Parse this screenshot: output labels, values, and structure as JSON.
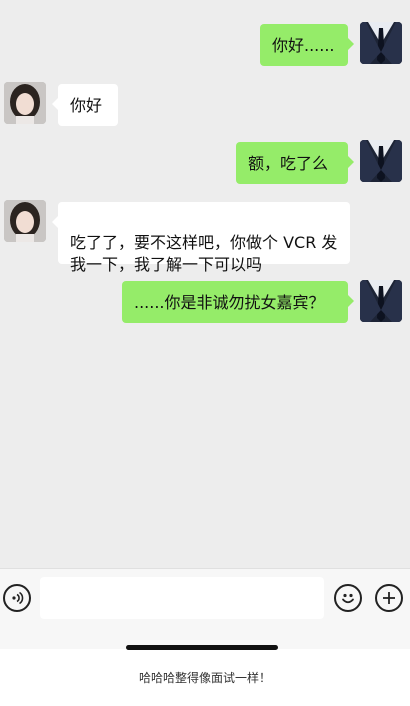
{
  "messages": [
    {
      "sender": "me",
      "text": "你好......"
    },
    {
      "sender": "them",
      "text": "你好"
    },
    {
      "sender": "me",
      "text": "额，吃了么"
    },
    {
      "sender": "them",
      "text": "吃了了，要不这样吧，你做个 VCR 发\n我一下，我了解一下可以吗"
    },
    {
      "sender": "me",
      "text": "......你是非诚勿扰女嘉宾？"
    }
  ],
  "input": {
    "value": "",
    "placeholder": ""
  },
  "icons": {
    "voice": "voice-icon",
    "emoji": "emoji-icon",
    "plus": "plus-icon"
  },
  "caption": "哈哈哈整得像面试一样！",
  "colors": {
    "outgoing_bubble": "#95ec69",
    "incoming_bubble": "#ffffff",
    "chat_background": "#ededed"
  }
}
